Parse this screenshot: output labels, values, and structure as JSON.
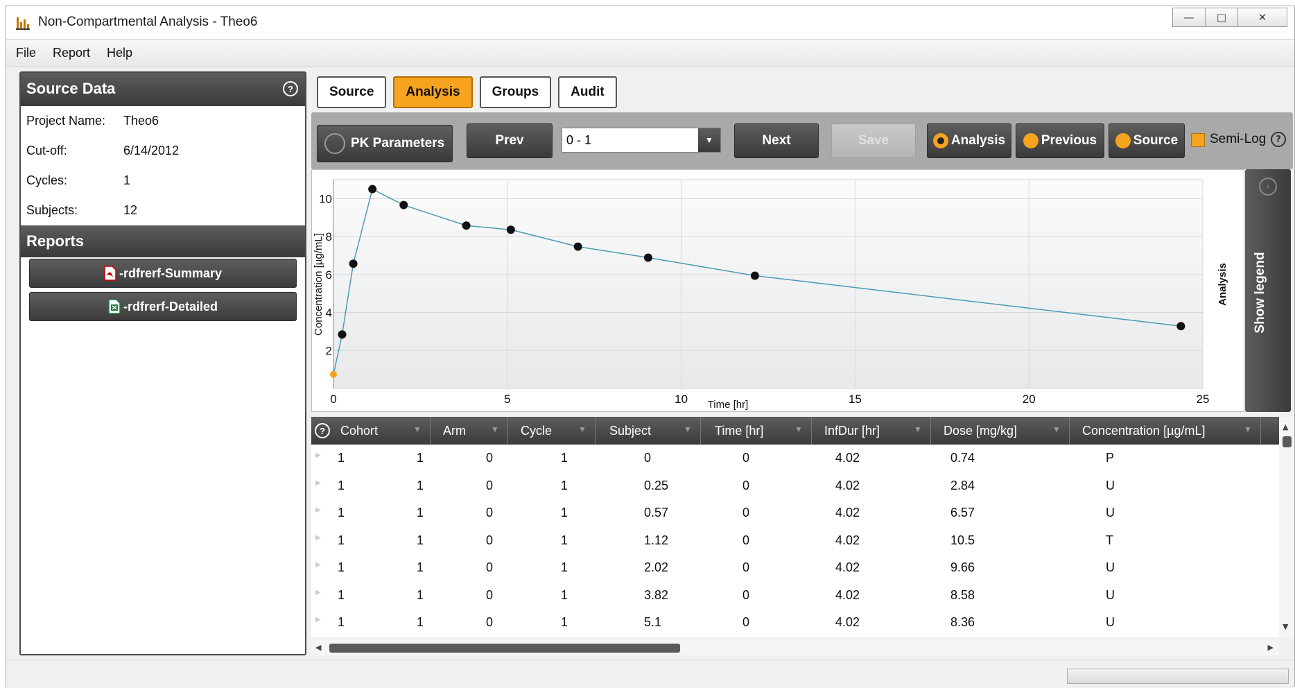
{
  "window": {
    "title": "Non-Compartmental Analysis - Theo6",
    "app_icon": "bar-chart-icon"
  },
  "menu": [
    "File",
    "Report",
    "Help"
  ],
  "source_data": {
    "heading": "Source Data",
    "help": "?",
    "fields": [
      {
        "label": "Project Name:",
        "value": "Theo6"
      },
      {
        "label": "Cut-off:",
        "value": "6/14/2012"
      },
      {
        "label": "Cycles:",
        "value": "1"
      },
      {
        "label": "Subjects:",
        "value": "12"
      }
    ]
  },
  "reports": {
    "heading": "Reports",
    "items": [
      {
        "label": "-rdfrerf-Summary",
        "icon": "pdf-icon"
      },
      {
        "label": "-rdfrerf-Detailed",
        "icon": "excel-icon"
      }
    ]
  },
  "tabs": [
    {
      "label": "Source",
      "active": false
    },
    {
      "label": "Analysis",
      "active": true
    },
    {
      "label": "Groups",
      "active": false
    },
    {
      "label": "Audit",
      "active": false
    }
  ],
  "toolbar": {
    "pk_parameters": "PK Parameters",
    "prev": "Prev",
    "selector_value": "0 - 1",
    "next": "Next",
    "save": "Save",
    "radio_analysis": "Analysis",
    "radio_previous": "Previous",
    "radio_source": "Source",
    "semi_log": "Semi-Log",
    "help": "?"
  },
  "legend_panel": {
    "label": "Show legend"
  },
  "chart_data": {
    "type": "line",
    "title": "",
    "xlabel": "Time [hr]",
    "ylabel": "Concentration [µg/mL]",
    "right_label": "Analysis",
    "xlim": [
      0,
      25
    ],
    "ylim": [
      0,
      11
    ],
    "xticks": [
      0,
      5,
      10,
      15,
      20,
      25
    ],
    "yticks": [
      2,
      4,
      6,
      8,
      10
    ],
    "grid": true,
    "series": [
      {
        "x": [
          0,
          0.25,
          0.57,
          1.12,
          2.02,
          3.82,
          5.1,
          7.03,
          9.05,
          12.12,
          24.37
        ],
        "y": [
          0.74,
          2.84,
          6.57,
          10.5,
          9.66,
          8.58,
          8.36,
          7.47,
          6.89,
          5.94,
          3.28
        ]
      }
    ],
    "colors": {
      "line": "#4a9bb3",
      "point": "#111111",
      "first_point": "#f6a320"
    }
  },
  "table": {
    "columns": [
      "Cohort",
      "Arm",
      "Cycle",
      "Subject",
      "Time [hr]",
      "InfDur [hr]",
      "Dose [mg/kg]",
      "Concentration [µg/mL]"
    ],
    "rows": [
      [
        "1",
        "1",
        "0",
        "1",
        "0",
        "0",
        "4.02",
        "0.74",
        "P"
      ],
      [
        "1",
        "1",
        "0",
        "1",
        "0.25",
        "0",
        "4.02",
        "2.84",
        "U"
      ],
      [
        "1",
        "1",
        "0",
        "1",
        "0.57",
        "0",
        "4.02",
        "6.57",
        "U"
      ],
      [
        "1",
        "1",
        "0",
        "1",
        "1.12",
        "0",
        "4.02",
        "10.5",
        "T"
      ],
      [
        "1",
        "1",
        "0",
        "1",
        "2.02",
        "0",
        "4.02",
        "9.66",
        "U"
      ],
      [
        "1",
        "1",
        "0",
        "1",
        "3.82",
        "0",
        "4.02",
        "8.58",
        "U"
      ],
      [
        "1",
        "1",
        "0",
        "1",
        "5.1",
        "0",
        "4.02",
        "8.36",
        "U"
      ]
    ]
  },
  "colors": {
    "accent": "#f6a320",
    "dark": "#3a3a3a"
  }
}
